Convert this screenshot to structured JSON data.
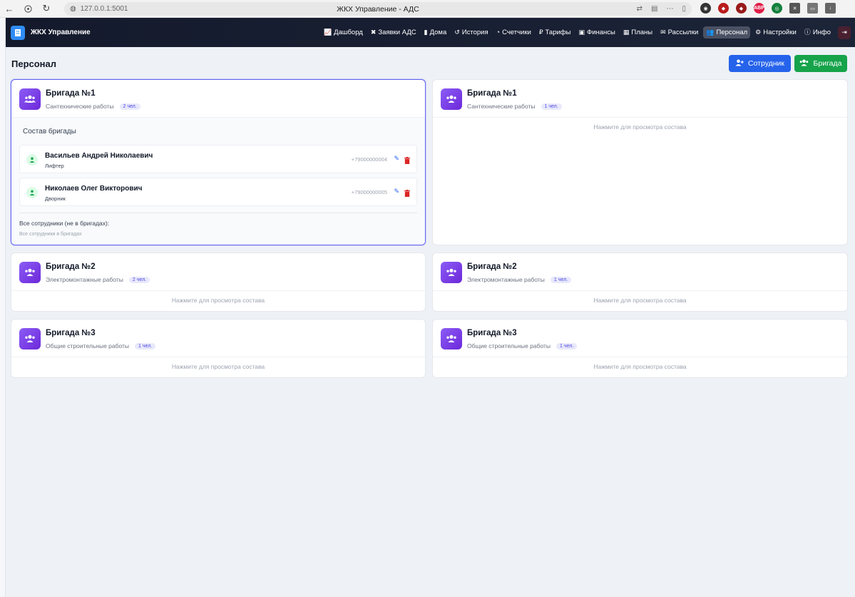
{
  "browser": {
    "url": "127.0.0.1:5001",
    "tab_title": "ЖКХ Управление - АДС"
  },
  "app": {
    "brand": "ЖКХ Управление",
    "nav": [
      {
        "label": "Дашборд",
        "icon": "chart-line-icon"
      },
      {
        "label": "Заявки АДС",
        "icon": "tools-icon"
      },
      {
        "label": "Дома",
        "icon": "building-icon"
      },
      {
        "label": "История",
        "icon": "history-icon"
      },
      {
        "label": "Счетчики",
        "icon": "gauge-icon"
      },
      {
        "label": "Тарифы",
        "icon": "ruble-icon"
      },
      {
        "label": "Финансы",
        "icon": "money-icon"
      },
      {
        "label": "Планы",
        "icon": "calendar-icon"
      },
      {
        "label": "Рассылки",
        "icon": "envelope-icon"
      },
      {
        "label": "Персонал",
        "icon": "users-icon",
        "active": true
      },
      {
        "label": "Настройки",
        "icon": "gear-icon"
      },
      {
        "label": "Инфо",
        "icon": "info-icon"
      }
    ]
  },
  "page": {
    "title": "Персонал",
    "add_employee_label": "Сотрудник",
    "add_team_label": "Бригада"
  },
  "colors": {
    "primary": "#2563eb",
    "success": "#16a34a",
    "team_icon": "#7c3aed",
    "navbar": "#141a2c"
  },
  "hint_text": "Нажмите для просмотра состава",
  "teams_left": [
    {
      "name": "Бригада №1",
      "spec": "Сантехнические работы",
      "count": "2 чел.",
      "expanded": true
    },
    {
      "name": "Бригада №2",
      "spec": "Электромонтажные работы",
      "count": "2 чел."
    },
    {
      "name": "Бригада №3",
      "spec": "Общие строительные работы",
      "count": "1 чел."
    }
  ],
  "teams_right": [
    {
      "name": "Бригада №1",
      "spec": "Сантехнические работы",
      "count": "1 чел."
    },
    {
      "name": "Бригада №2",
      "spec": "Электромонтажные работы",
      "count": "1 чел."
    },
    {
      "name": "Бригада №3",
      "spec": "Общие строительные работы",
      "count": "1 чел."
    }
  ],
  "expanded_team": {
    "members_title": "Состав бригады",
    "members": [
      {
        "name": "Васильев Андрей Николаевич",
        "role": "Лифтер",
        "phone": "+79000000004"
      },
      {
        "name": "Николаев Олег Викторович",
        "role": "Дворник",
        "phone": "+79000000005"
      }
    ],
    "others_label": "Все сотрудники (не в бригадах):",
    "others_value": "Все сотрудники в бригадах"
  }
}
